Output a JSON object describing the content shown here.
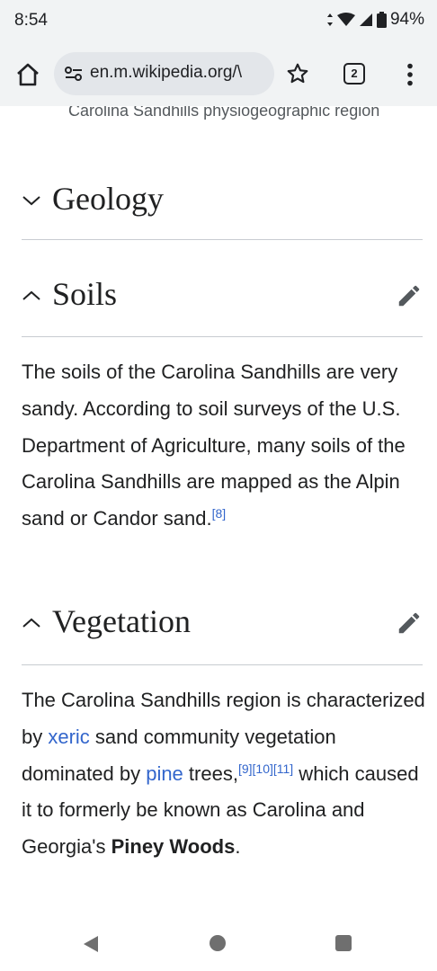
{
  "status_bar": {
    "time": "8:54",
    "battery": "94%"
  },
  "browser": {
    "url": "en.m.wikipedia.org/\\",
    "tab_count": "2"
  },
  "article": {
    "caption": "Carolina Sandhills physiogeographic region",
    "sections": {
      "geology": {
        "title": "Geology",
        "state": "collapsed"
      },
      "soils": {
        "title": "Soils",
        "state": "expanded",
        "text": "The soils of the Carolina Sandhills are very sandy. According to soil surveys of the U.S. Department of Agriculture, many soils of the Carolina Sandhills are mapped as the Alpin sand or Candor sand.",
        "text_parts": [
          "The soils of the Carolina Sandhills are very sandy. According to soil surveys of the U.S. Department of Agriculture, many soils of the Carolina Sandhills are mapped as the Alpin sand or Candor sand."
        ],
        "refs": [
          "[8]"
        ]
      },
      "vegetation": {
        "title": "Vegetation",
        "state": "expanded",
        "p1": "The Carolina Sandhills region is characterized by ",
        "link_xeric": "xeric",
        "p2": " sand community vegetation dominated by ",
        "link_pine": "pine",
        "p3": " trees,",
        "refs": [
          "[9]",
          "[10]",
          "[11]"
        ],
        "p4": " which caused it to formerly be known as Carolina and Georgia's ",
        "bold": "Piney Woods",
        "p5": "."
      }
    }
  },
  "colors": {
    "link": "#3366cc",
    "text": "#202122",
    "chrome": "#f1f3f4",
    "rule": "#c8ccd1"
  }
}
